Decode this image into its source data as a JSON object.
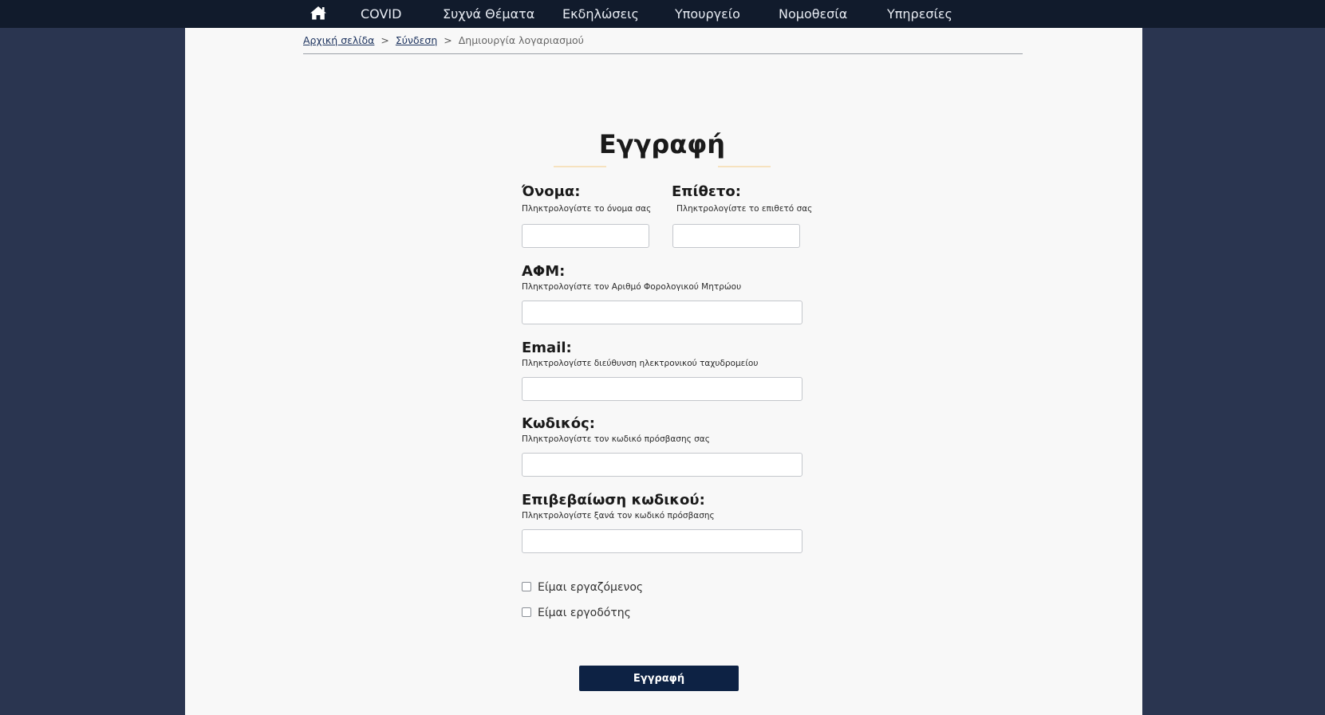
{
  "nav": {
    "home_icon": "home-icon",
    "items": [
      {
        "label": "COVID"
      },
      {
        "label": "Συχνά Θέματα"
      },
      {
        "label": "Εκδηλώσεις"
      },
      {
        "label": "Υπουργείο"
      },
      {
        "label": "Νομοθεσία"
      },
      {
        "label": "Υπηρεσίες"
      }
    ]
  },
  "breadcrumb": {
    "home": "Αρχική σελίδα",
    "login": "Σύνδεση",
    "current": "Δημιουργία λογαριασμού",
    "separator": ">"
  },
  "form": {
    "title": "Εγγραφή",
    "first_name": {
      "label": "Όνομα:",
      "hint": "Πληκτρολογίστε το όνομα σας",
      "value": ""
    },
    "last_name": {
      "label": "Επίθετο:",
      "hint": "Πληκτρολογίστε το επιθετό σας",
      "value": ""
    },
    "afm": {
      "label": "ΑΦΜ:",
      "hint": "Πληκτρολογίστε τον Αριθμό Φορολογικού Μητρώου",
      "value": ""
    },
    "email": {
      "label": "Email:",
      "hint": "Πληκτρολογίστε διεύθυνση ηλεκτρονικού ταχυδρομείου",
      "value": ""
    },
    "password": {
      "label": "Κωδικός:",
      "hint": "Πληκτρολογίστε τον κωδικό πρόσβασης σας",
      "value": ""
    },
    "password_confirm": {
      "label": "Επιβεβαίωση κωδικού:",
      "hint": "Πληκτρολογίστε ξανά τον κωδικό πρόσβασης",
      "value": ""
    },
    "checkbox_employee": {
      "label": "Είμαι εργαζόμενος",
      "checked": false
    },
    "checkbox_employer": {
      "label": "Είμαι εργοδότης",
      "checked": false
    },
    "submit_label": "Εγγραφή"
  },
  "colors": {
    "nav_bg": "#111b2c",
    "page_bg": "#2a3550",
    "content_bg": "#f8f8f8",
    "accent_line": "#f6e2bf",
    "button_bg": "#0d2244"
  }
}
